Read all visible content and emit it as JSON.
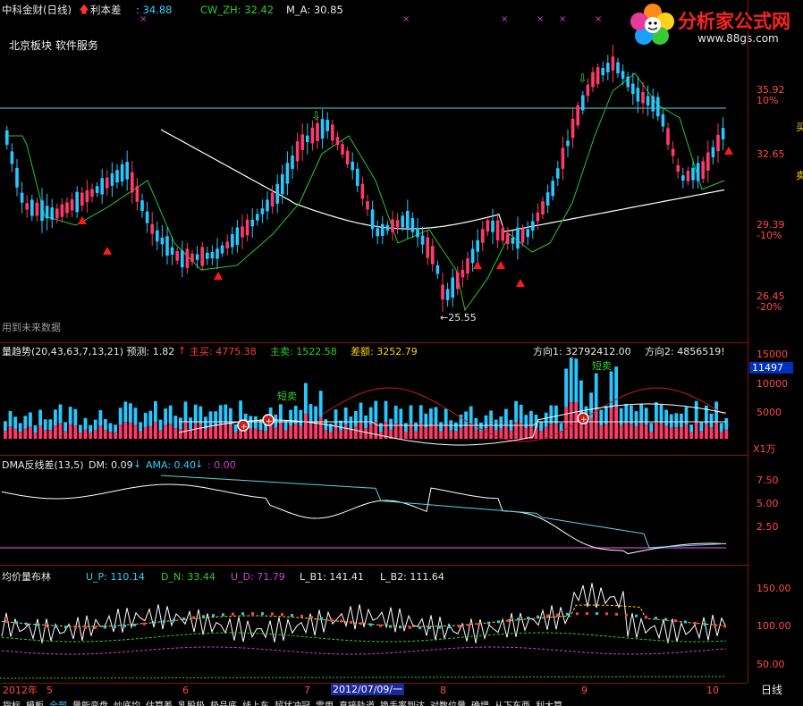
{
  "main_panel": {
    "title": "中科金财(日线)",
    "lb_label": "利本差",
    "lb_value": "34.88",
    "cw_label": "CW_ZH: 32.42",
    "ma_label": "M_A: 30.85",
    "sector": "北京板块 软件服务",
    "future_note": "用到未来数据",
    "low_label": "←25.55",
    "signal_short": "短卖",
    "axis": {
      "p1": "35.92",
      "p1_pct": "10%",
      "p2": "32.65",
      "p3": "29.39",
      "p3_pct": "-10%",
      "p4": "26.45",
      "p4_pct": "-20%"
    },
    "side_chars": [
      "买",
      "卖"
    ]
  },
  "watermark": {
    "name": "分析家公式网",
    "url": "www.88gs.com"
  },
  "volume_panel": {
    "header": "量趋势(20,43,63,7,13,21) 预测: 1.82",
    "main_buy": "主买: 4775.38",
    "main_sell": "主卖: 1522.58",
    "diff": "差额: 3252.79",
    "dir1": "方向1: 32792412.00",
    "dir2": "方向2: 4856519!",
    "short_sell_1": "短卖",
    "short_sell_2": "短卖",
    "axis": {
      "v1": "15000",
      "v2": "11497",
      "v3": "10000",
      "v4": "5000",
      "unit": "X1万"
    }
  },
  "dma_panel": {
    "header": "DMA反线差(13,5)",
    "dm": "DM: 0.09",
    "ama": "AMA: 0.40",
    "zero": ": 0.00",
    "axis": {
      "v1": "7.50",
      "v2": "5.00",
      "v3": "2.50"
    }
  },
  "boll_panel": {
    "header": "均价量布林",
    "up": "U_P: 110.14",
    "dn": "D_N: 33.44",
    "ud": "U_D: 71.79",
    "lb1": "L_B1: 141.41",
    "lb2": "L_B2: 111.64",
    "axis": {
      "v1": "150.00",
      "v2": "100.00",
      "v3": "50.00"
    }
  },
  "date_axis": {
    "year": "2012年",
    "m5": "5",
    "m6": "6",
    "m7": "7",
    "cursor_date": "2012/07/09/一",
    "m8": "8",
    "m9": "9",
    "m10": "10",
    "period": "日线"
  },
  "tabs": [
    "指标",
    "模板",
    "全部",
    "量能变盘",
    "炒底均",
    "估算差",
    "乳股极",
    "极品底",
    "线上车",
    "超状冲冠",
    "雷用",
    "直接轨道",
    "换手率到达",
    "对数位量",
    "确增",
    "从下东西",
    "利大算"
  ],
  "colors": {
    "up": "#ff3a6a",
    "down": "#25c8ff",
    "grid": "#8a1010",
    "white_line": "#ffffff",
    "green_line": "#28c828"
  }
}
